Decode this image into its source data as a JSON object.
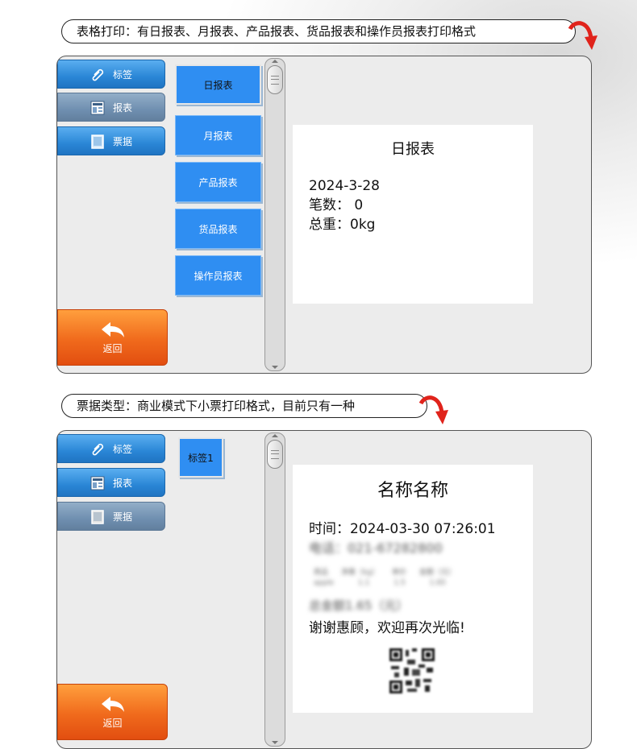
{
  "section1": {
    "caption": "表格打印：有日报表、月报表、产品报表、货品报表和操作员报表打印格式",
    "sidebar": [
      {
        "label": "标签",
        "icon": "paperclip-icon",
        "state": "active"
      },
      {
        "label": "报表",
        "icon": "report-icon",
        "state": "dim"
      },
      {
        "label": "票据",
        "icon": "receipt-icon",
        "state": "active"
      }
    ],
    "back_label": "返回",
    "tabs": [
      "日报表",
      "月报表",
      "产品报表",
      "货品报表",
      "操作员报表"
    ],
    "preview": {
      "title": "日报表",
      "lines": [
        "2024-3-28",
        "笔数： 0",
        "总重：0kg"
      ]
    }
  },
  "section2": {
    "caption": "票据类型：商业模式下小票打印格式，目前只有一种",
    "sidebar": [
      {
        "label": "标签",
        "icon": "paperclip-icon",
        "state": "active"
      },
      {
        "label": "报表",
        "icon": "report-icon",
        "state": "active"
      },
      {
        "label": "票据",
        "icon": "receipt-icon",
        "state": "dim"
      }
    ],
    "back_label": "返回",
    "tabs": [
      "标签1"
    ],
    "preview": {
      "title": "名称名称",
      "time": "时间：2024-03-30 07:26:01",
      "phone": "电话：021-67282800",
      "table_headers": [
        "商品",
        "净重（kg）",
        "单价",
        "金额（元）"
      ],
      "table_row": [
        "apple",
        "1.1",
        "1.5",
        "1.65"
      ],
      "total": "总金额1.65（元）",
      "thanks": "谢谢惠顾，欢迎再次光临!",
      "qr_icon": "qr-code-icon"
    }
  },
  "colors": {
    "accent_blue": "#2f8ef2",
    "back_orange": "#f06a1c",
    "arrow_red": "#e0231b"
  }
}
